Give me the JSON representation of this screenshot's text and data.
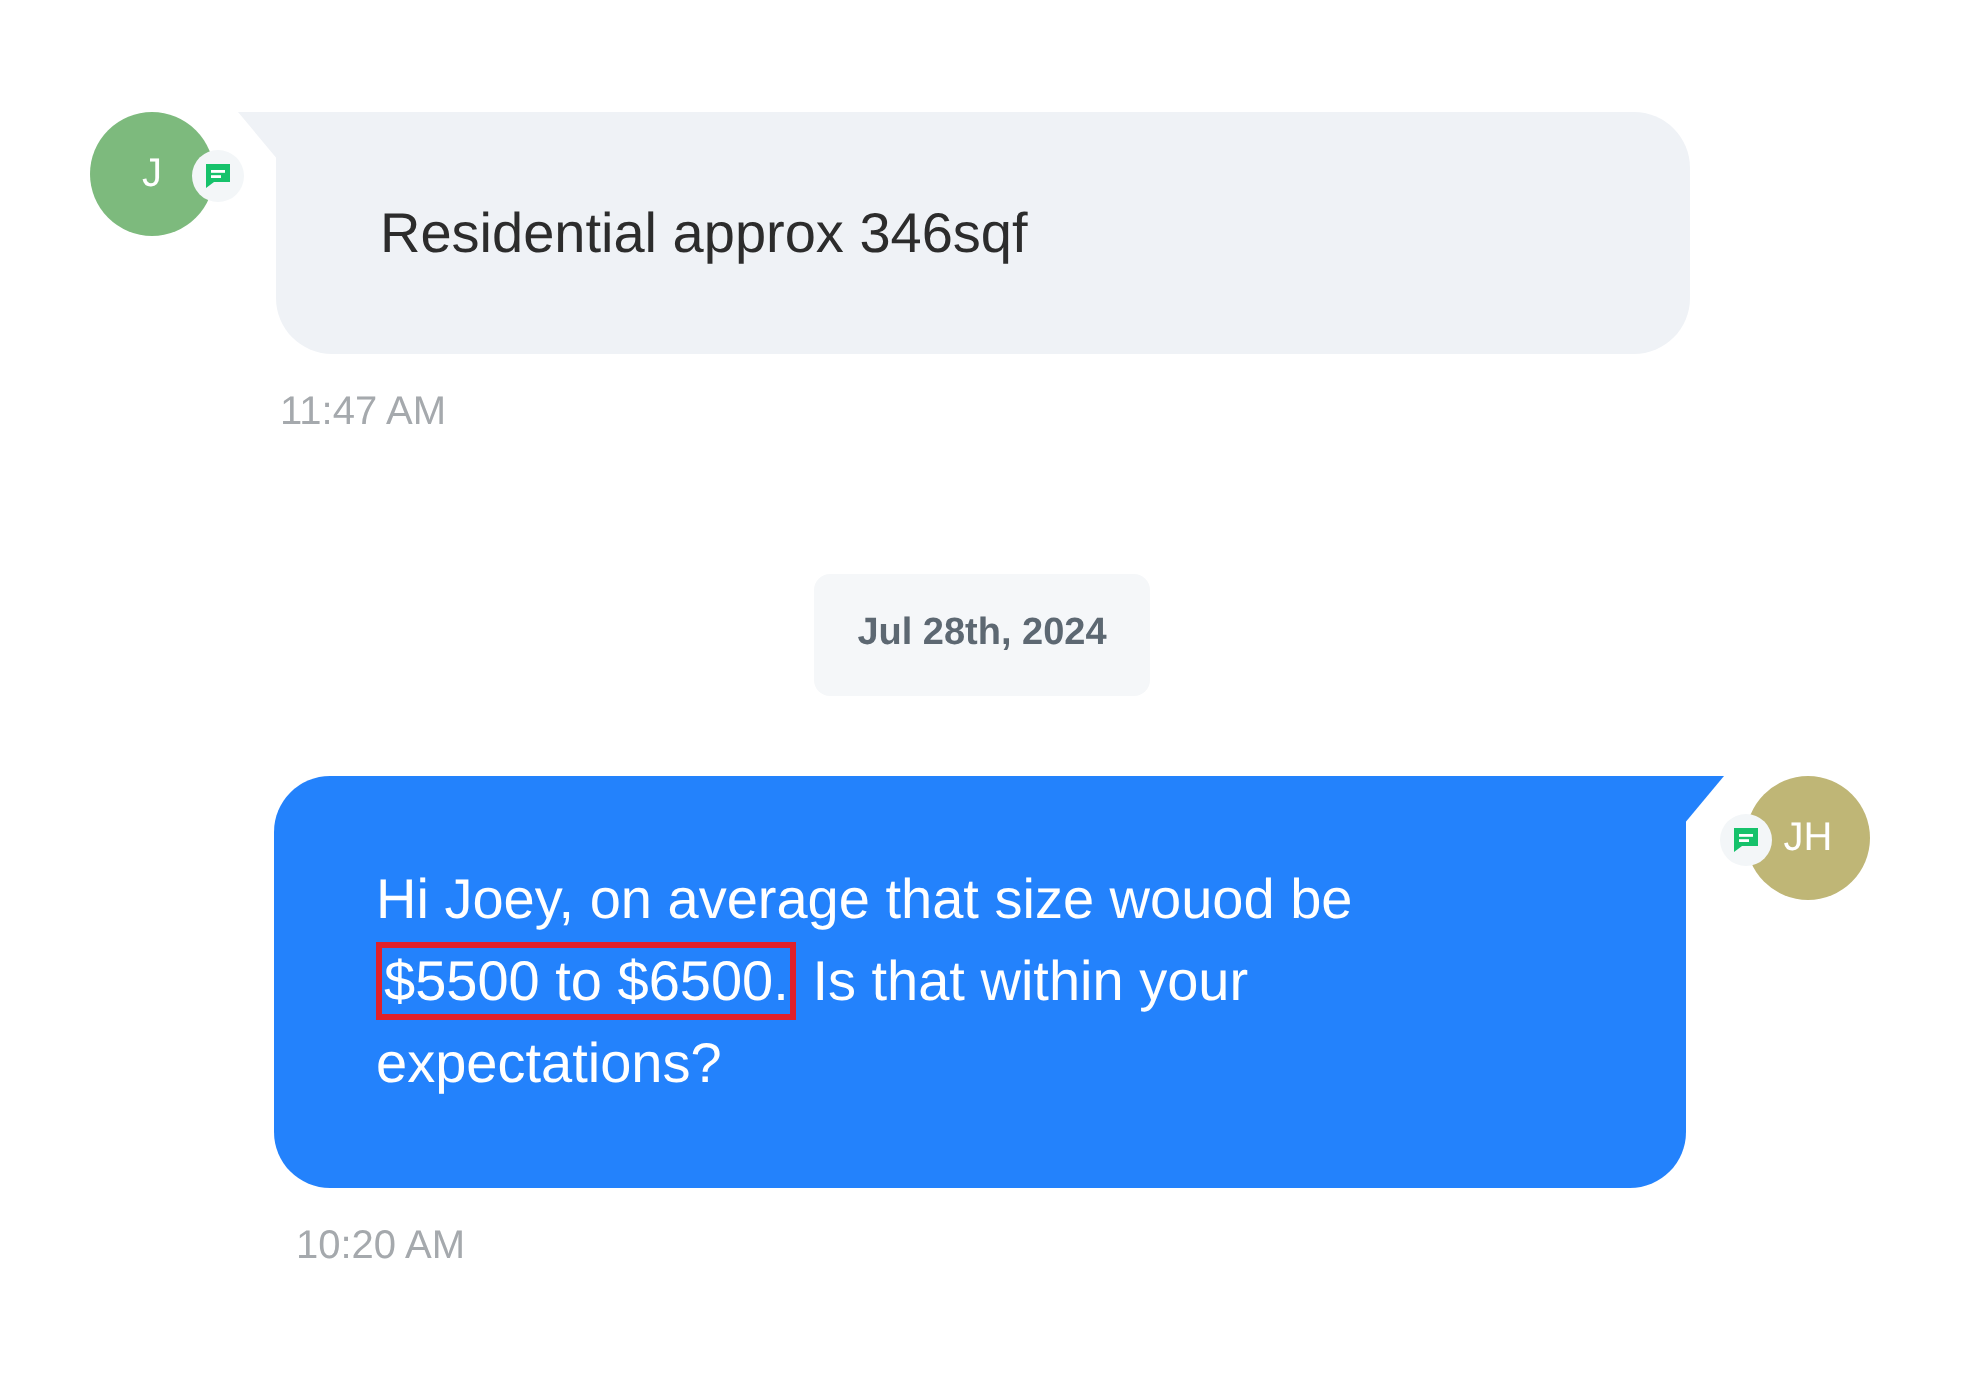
{
  "messages": [
    {
      "kind": "incoming",
      "avatar": {
        "initials": "J",
        "color": "#7dba7d"
      },
      "parts": [
        {
          "text": "Residential approx 346sqf",
          "highlighted": false
        }
      ],
      "time": "11:47 AM"
    },
    {
      "kind": "date",
      "text": "Jul 28th, 2024"
    },
    {
      "kind": "outgoing",
      "avatar": {
        "initials": "JH",
        "color": "#bfb676"
      },
      "parts": [
        {
          "text": "Hi Joey, on average that size wouod be ",
          "highlighted": false
        },
        {
          "text": "$5500 to $6500.",
          "highlighted": true
        },
        {
          "text": " Is that within your expectations?",
          "highlighted": false
        }
      ],
      "time": "10:20 AM"
    }
  ]
}
